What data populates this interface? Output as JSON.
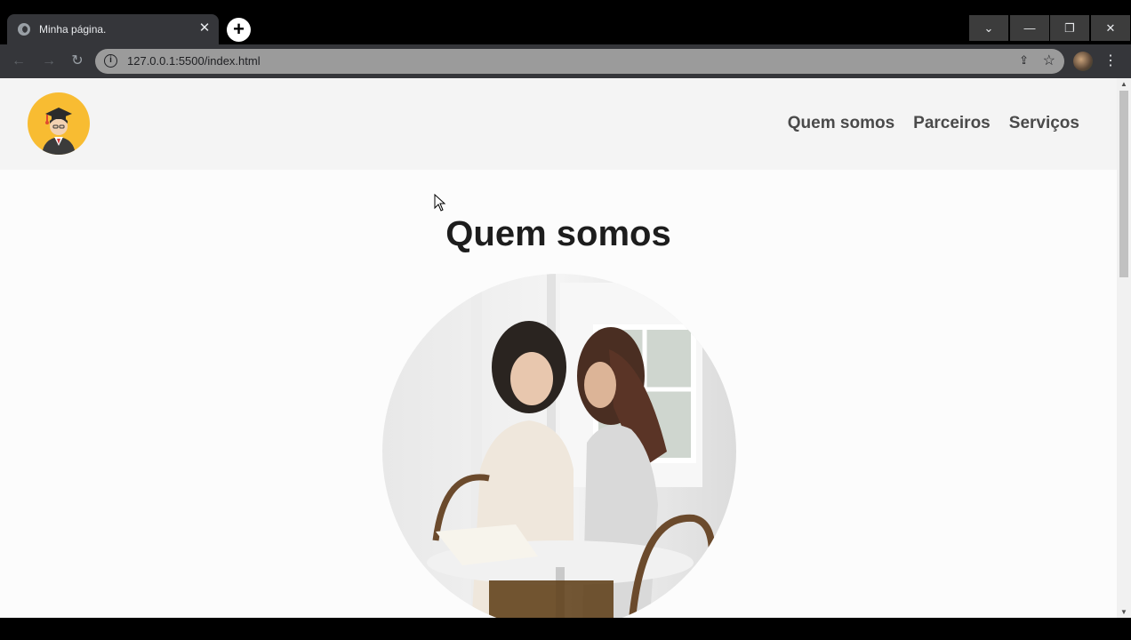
{
  "browser": {
    "tab_title": "Minha página.",
    "tab_close": "✕",
    "new_tab": "+",
    "url": "127.0.0.1:5500/index.html",
    "info_icon": "i",
    "window_controls": {
      "dropdown": "⌄",
      "minimize": "—",
      "maximize": "❐",
      "close": "✕"
    }
  },
  "header": {
    "nav": [
      "Quem somos",
      "Parceiros",
      "Serviços"
    ]
  },
  "main": {
    "title": "Quem somos"
  },
  "colors": {
    "logo_bg": "#f8bc32",
    "header_bg": "#f4f4f4",
    "nav_text": "#4a4a4a"
  }
}
